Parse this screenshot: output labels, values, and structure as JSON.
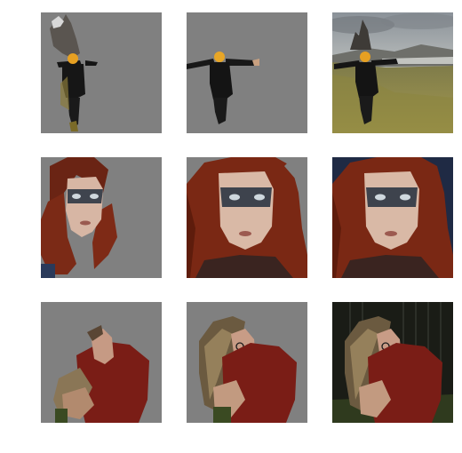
{
  "figure": {
    "background": "#ffffff",
    "mask_gray": "#808080",
    "rows": [
      {
        "subject": "person-with-outstretched-arms",
        "tiles": [
          {
            "variant": "segmented-mask"
          },
          {
            "variant": "segmented-mask"
          },
          {
            "variant": "full-photo"
          }
        ]
      },
      {
        "subject": "red-haired-woman-portrait",
        "tiles": [
          {
            "variant": "segmented-mask"
          },
          {
            "variant": "segmented-mask"
          },
          {
            "variant": "full-photo"
          }
        ]
      },
      {
        "subject": "woman-in-red-shirt-with-glasses",
        "tiles": [
          {
            "variant": "segmented-mask"
          },
          {
            "variant": "segmented-mask"
          },
          {
            "variant": "full-photo"
          }
        ]
      }
    ]
  }
}
